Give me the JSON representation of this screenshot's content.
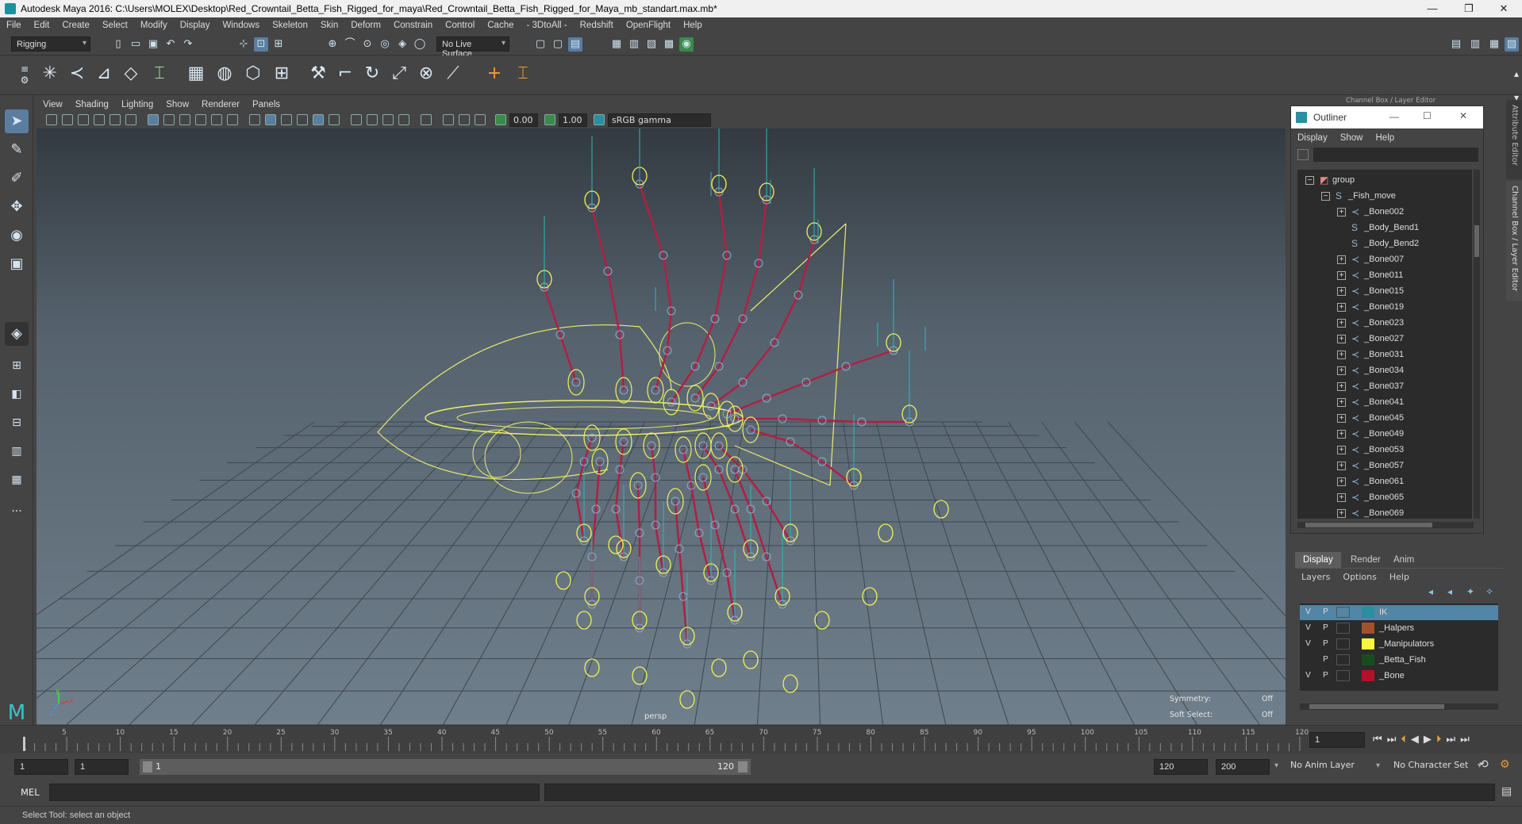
{
  "window": {
    "title": "Autodesk Maya 2016: C:\\Users\\MOLEX\\Desktop\\Red_Crowntail_Betta_Fish_Rigged_for_maya\\Red_Crowntail_Betta_Fish_Rigged_for_Maya_mb_standart.max.mb*",
    "minimize": "—",
    "restore": "❐",
    "close": "✕"
  },
  "menubar": [
    "File",
    "Edit",
    "Create",
    "Select",
    "Modify",
    "Display",
    "Windows",
    "Skeleton",
    "Skin",
    "Deform",
    "Constrain",
    "Control",
    "Cache",
    "- 3DtoAll -",
    "Redshift",
    "OpenFlight",
    "Help"
  ],
  "status": {
    "menuset": "Rigging",
    "live_surface": "No Live Surface"
  },
  "viewport": {
    "menus": [
      "View",
      "Shading",
      "Lighting",
      "Show",
      "Renderer",
      "Panels"
    ],
    "exposure": "0.00",
    "gamma": "1.00",
    "color_space": "sRGB gamma",
    "camera_label": "persp",
    "symmetry_label": "Symmetry:",
    "symmetry_value": "Off",
    "soft_select_label": "Soft Select:",
    "soft_select_value": "Off",
    "axis_x": "x",
    "axis_y": "y",
    "axis_z": "z"
  },
  "outliner": {
    "title": "Outliner",
    "panel_label": "Channel Box / Layer Editor",
    "menus": [
      "Display",
      "Show",
      "Help"
    ],
    "items": [
      {
        "label": "group",
        "depth": 0,
        "kind": "group",
        "expand": "−"
      },
      {
        "label": "_Fish_move",
        "depth": 1,
        "kind": "curve",
        "expand": "−"
      },
      {
        "label": "_Bone002",
        "depth": 2,
        "kind": "bone",
        "expand": "+"
      },
      {
        "label": "_Body_Bend1",
        "depth": 2,
        "kind": "curve",
        "expand": ""
      },
      {
        "label": "_Body_Bend2",
        "depth": 2,
        "kind": "curve",
        "expand": ""
      },
      {
        "label": "_Bone007",
        "depth": 2,
        "kind": "bone",
        "expand": "+"
      },
      {
        "label": "_Bone011",
        "depth": 2,
        "kind": "bone",
        "expand": "+"
      },
      {
        "label": "_Bone015",
        "depth": 2,
        "kind": "bone",
        "expand": "+"
      },
      {
        "label": "_Bone019",
        "depth": 2,
        "kind": "bone",
        "expand": "+"
      },
      {
        "label": "_Bone023",
        "depth": 2,
        "kind": "bone",
        "expand": "+"
      },
      {
        "label": "_Bone027",
        "depth": 2,
        "kind": "bone",
        "expand": "+"
      },
      {
        "label": "_Bone031",
        "depth": 2,
        "kind": "bone",
        "expand": "+"
      },
      {
        "label": "_Bone034",
        "depth": 2,
        "kind": "bone",
        "expand": "+"
      },
      {
        "label": "_Bone037",
        "depth": 2,
        "kind": "bone",
        "expand": "+"
      },
      {
        "label": "_Bone041",
        "depth": 2,
        "kind": "bone",
        "expand": "+"
      },
      {
        "label": "_Bone045",
        "depth": 2,
        "kind": "bone",
        "expand": "+"
      },
      {
        "label": "_Bone049",
        "depth": 2,
        "kind": "bone",
        "expand": "+"
      },
      {
        "label": "_Bone053",
        "depth": 2,
        "kind": "bone",
        "expand": "+"
      },
      {
        "label": "_Bone057",
        "depth": 2,
        "kind": "bone",
        "expand": "+"
      },
      {
        "label": "_Bone061",
        "depth": 2,
        "kind": "bone",
        "expand": "+"
      },
      {
        "label": "_Bone065",
        "depth": 2,
        "kind": "bone",
        "expand": "+"
      },
      {
        "label": "_Bone069",
        "depth": 2,
        "kind": "bone",
        "expand": "+"
      }
    ]
  },
  "side_tabs": {
    "attribute_editor": "Attribute Editor",
    "channel_box": "Channel Box / Layer Editor"
  },
  "layer_editor": {
    "tabs": [
      "Display",
      "Render",
      "Anim"
    ],
    "menus": [
      "Layers",
      "Options",
      "Help"
    ],
    "layers": [
      {
        "name": "IK",
        "v": "V",
        "p": "P",
        "color": "#2a8fa0",
        "selected": true
      },
      {
        "name": "_Halpers",
        "v": "V",
        "p": "P",
        "color": "#a0522d",
        "selected": false
      },
      {
        "name": "_Manipulators",
        "v": "V",
        "p": "P",
        "color": "#f5f542",
        "selected": false
      },
      {
        "name": "_Betta_Fish",
        "v": "",
        "p": "P",
        "color": "#174d1e",
        "selected": false
      },
      {
        "name": "_Bone",
        "v": "V",
        "p": "P",
        "color": "#b3102a",
        "selected": false
      }
    ]
  },
  "timeline": {
    "ticks": [
      "5",
      "10",
      "15",
      "20",
      "25",
      "30",
      "35",
      "40",
      "45",
      "50",
      "55",
      "60",
      "65",
      "70",
      "75",
      "80",
      "85",
      "90",
      "95",
      "100",
      "105",
      "110",
      "115",
      "120"
    ],
    "start_tick": "1",
    "current_frame": "1"
  },
  "range": {
    "start": "1",
    "anim_start": "1",
    "slider_start": "1",
    "slider_end": "120",
    "end": "120",
    "anim_end": "200",
    "anim_layer": "No Anim Layer",
    "char_set": "No Character Set"
  },
  "command": {
    "language": "MEL"
  },
  "help": {
    "text": "Select Tool: select an object"
  }
}
